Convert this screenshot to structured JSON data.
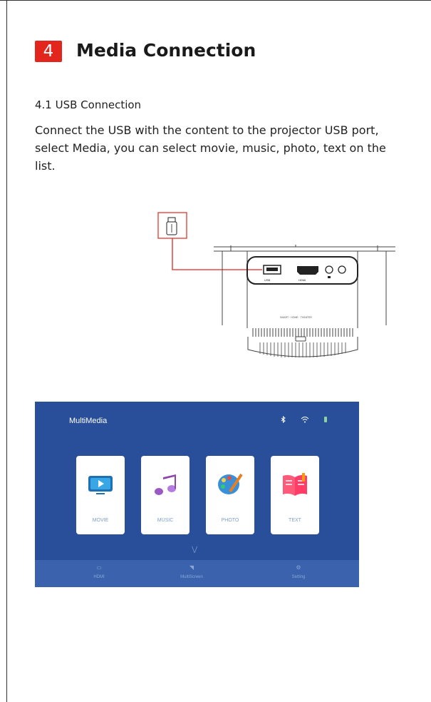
{
  "section": {
    "number": "4",
    "title": "Media Connection"
  },
  "subsection": "4.1 USB Connection",
  "paragraph": "Connect the USB with the content to the projector USB port, select Media, you can select movie, music, photo, text on the list.",
  "diagram": {
    "port_labels": {
      "usb": "USB",
      "hdmi": "HDMI"
    },
    "device_text": "SMART · HOME · THEATER"
  },
  "tv": {
    "title": "MultiMedia",
    "cards": [
      {
        "label": "MOVIE",
        "icon": "movie-icon"
      },
      {
        "label": "MUSIC",
        "icon": "music-icon"
      },
      {
        "label": "PHOTO",
        "icon": "photo-icon"
      },
      {
        "label": "TEXT",
        "icon": "text-icon"
      }
    ],
    "bottom": [
      {
        "label": "HDMI",
        "icon": "hdmi-icon"
      },
      {
        "label": "MultiScreen",
        "icon": "multiscreen-icon"
      },
      {
        "label": "Setting",
        "icon": "setting-icon"
      }
    ],
    "colors": {
      "background": "#2a4f9a",
      "bottom_bar": "#3a62ad",
      "accent_red": "#e2261d"
    }
  }
}
